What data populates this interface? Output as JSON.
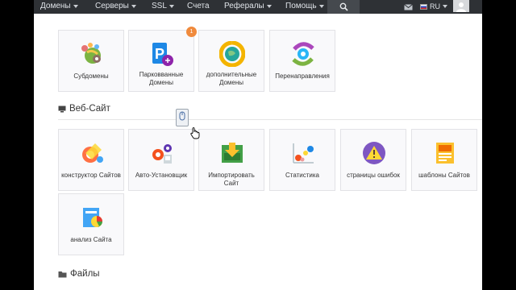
{
  "nav": {
    "items": [
      "Домены",
      "Серверы",
      "SSL",
      "Счета",
      "Рефералы",
      "Помощь"
    ],
    "language": "RU"
  },
  "domains_tiles": [
    {
      "label": "Субдомены",
      "icon": "subdomains-icon"
    },
    {
      "label": "Парковванные Домены",
      "icon": "parked-domains-icon",
      "badge": "1"
    },
    {
      "label": "дополнительные Домены",
      "icon": "addon-domains-icon"
    },
    {
      "label": "Перенаправления",
      "icon": "redirects-icon"
    }
  ],
  "website_section": {
    "title": "Веб-Сайт",
    "tiles": [
      {
        "label": "конструктор Сайтов",
        "icon": "site-builder-icon"
      },
      {
        "label": "Авто-Установщик",
        "icon": "auto-installer-icon"
      },
      {
        "label": "Импортировать Сайт",
        "icon": "import-site-icon"
      },
      {
        "label": "Статистика",
        "icon": "statistics-icon"
      },
      {
        "label": "страницы ошибок",
        "icon": "error-pages-icon"
      },
      {
        "label": "шаблоны Сайтов",
        "icon": "site-templates-icon"
      },
      {
        "label": "анализ Сайта",
        "icon": "site-analysis-icon"
      }
    ]
  },
  "files_section": {
    "title": "Файлы"
  },
  "colors": {
    "nav_bg": "#2e3135",
    "badge": "#f08a3c",
    "tile_border": "#e2e2e6"
  }
}
